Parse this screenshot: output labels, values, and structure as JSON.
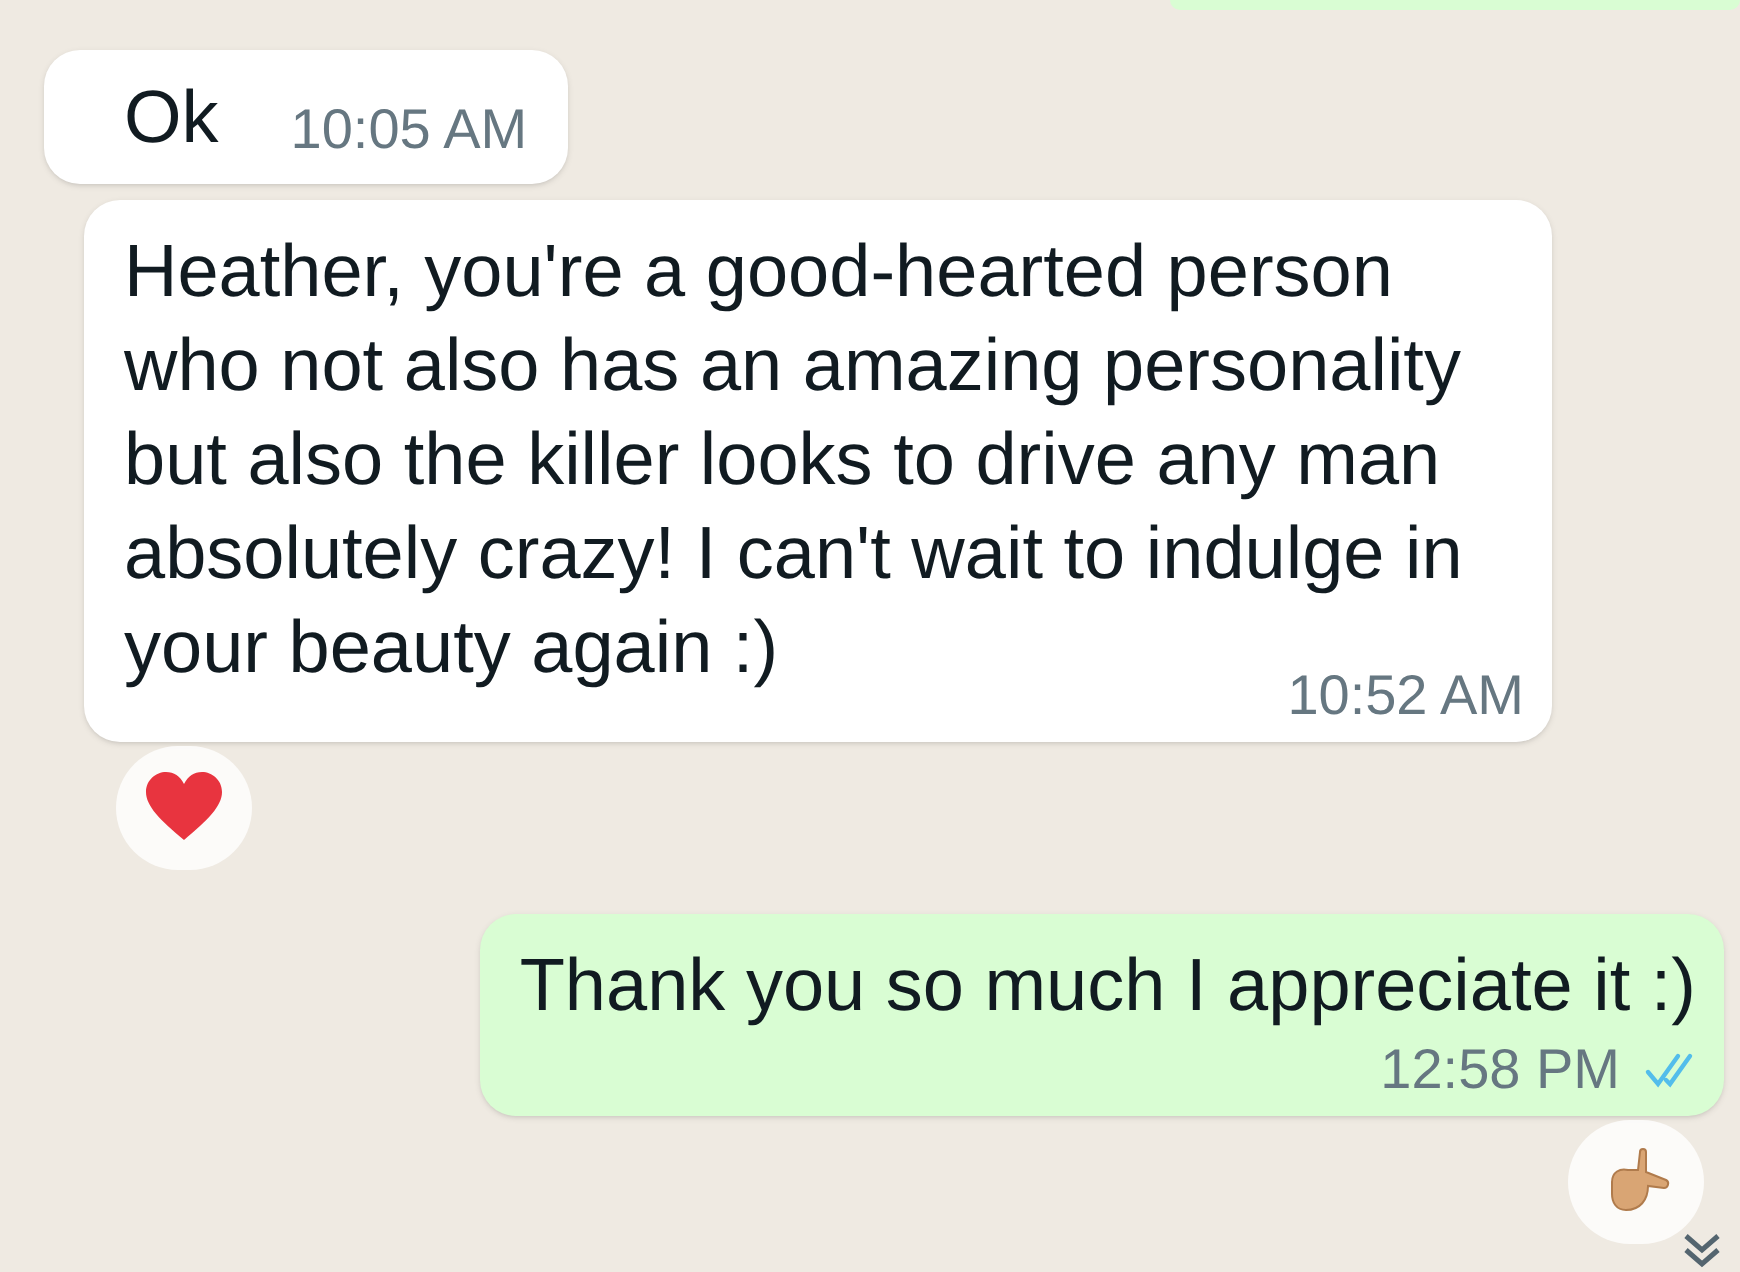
{
  "messages": [
    {
      "kind": "incoming",
      "text": "Ok",
      "time": "10:05 AM"
    },
    {
      "kind": "incoming",
      "text": "Heather, you're a good-hearted person who not also has an amazing personality but also the killer looks to drive any man absolutely crazy! I can't wait to indulge in your beauty again :)",
      "time": "10:52 AM",
      "reaction": {
        "kind": "heart"
      }
    },
    {
      "kind": "outgoing",
      "text": "Thank you so much I appreciate it :)",
      "time": "12:58 PM",
      "read": true,
      "reaction": {
        "kind": "pointing-hand"
      }
    }
  ]
}
